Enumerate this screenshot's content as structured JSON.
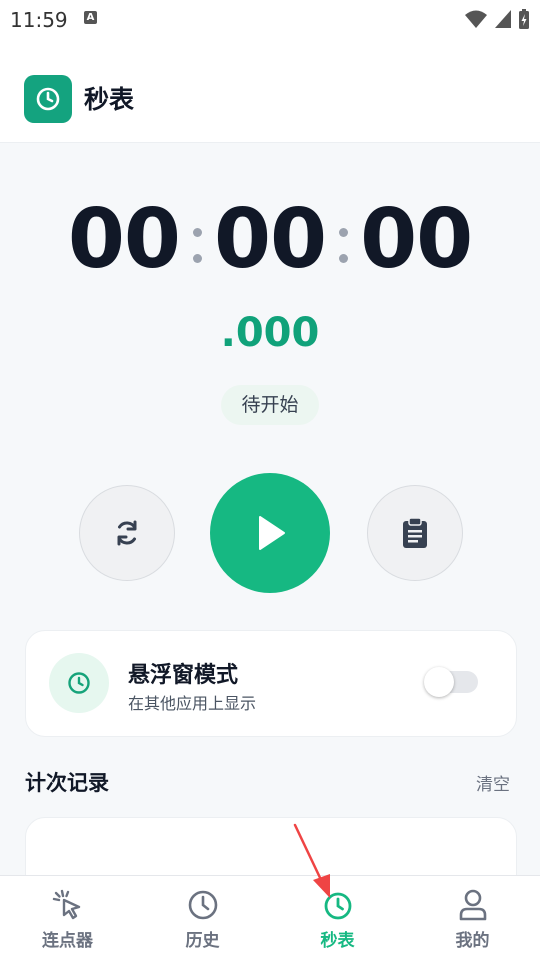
{
  "status_bar": {
    "time": "11:59",
    "badge": "A"
  },
  "app_bar": {
    "title": "秒表",
    "icon": "clock-icon"
  },
  "timer": {
    "hours": "00",
    "minutes": "00",
    "seconds": "00",
    "milliseconds": ".000",
    "status": "待开始"
  },
  "controls": {
    "reset_icon": "refresh-icon",
    "play_icon": "play-icon",
    "record_icon": "clipboard-icon"
  },
  "floating_window": {
    "title": "悬浮窗模式",
    "subtitle": "在其他应用上显示",
    "enabled": false
  },
  "records": {
    "title": "计次记录",
    "clear_label": "清空"
  },
  "bottom_nav": {
    "items": [
      {
        "label": "连点器",
        "icon": "cursor-click-icon",
        "active": false
      },
      {
        "label": "历史",
        "icon": "clock-icon",
        "active": false
      },
      {
        "label": "秒表",
        "icon": "stopwatch-icon",
        "active": true
      },
      {
        "label": "我的",
        "icon": "user-icon",
        "active": false
      }
    ]
  },
  "colors": {
    "accent": "#16b882",
    "accent_dark": "#14a37f",
    "text": "#111827",
    "muted": "#6b7280",
    "arrow": "#ef4444"
  }
}
